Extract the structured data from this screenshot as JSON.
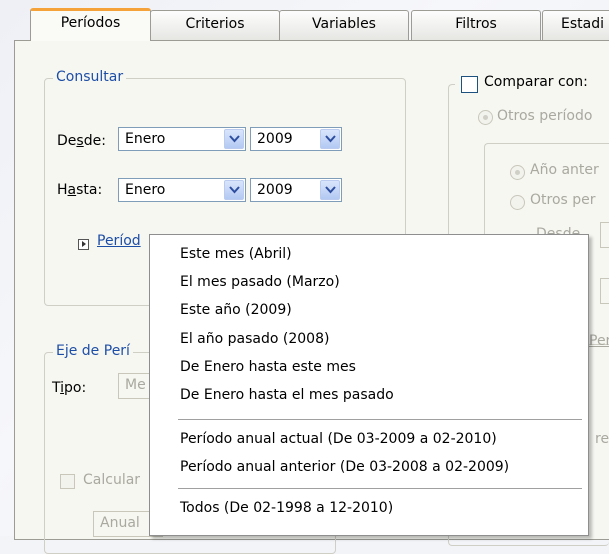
{
  "tabs": [
    {
      "label": "Períodos",
      "active": true
    },
    {
      "label": "Criterios"
    },
    {
      "label": "Variables"
    },
    {
      "label": "Filtros"
    },
    {
      "label": "Estadi"
    }
  ],
  "consultar": {
    "legend": "Consultar",
    "desde_label": "Desde:",
    "hasta_label": "Hasta:",
    "desde_month": "Enero",
    "desde_year": "2009",
    "hasta_month": "Enero",
    "hasta_year": "2009",
    "periods_link": "Períod"
  },
  "eje": {
    "legend": "Eje de Perí",
    "tipo_label": "Tipo:",
    "tipo_value": "Me",
    "calcular_label": "Calcular",
    "anual_value": "Anual"
  },
  "comparar": {
    "label": "Comparar con:",
    "otros_periodos": "Otros período",
    "anio_anterior": "Año anter",
    "otros_per": "Otros per",
    "desde_partial": "Desde",
    "per_partial": "Per",
    "re_partial": "re"
  },
  "menu": {
    "items": [
      "Este mes (Abril)",
      "El mes pasado (Marzo)",
      "Este año (2009)",
      "El año pasado (2008)",
      "De Enero hasta este mes",
      "De Enero hasta el mes pasado",
      "Período anual actual (De 03-2009 a 02-2010)",
      "Período anual anterior (De 03-2008 a 02-2009)",
      "Todos (De 02-1998 a 12-2010)"
    ]
  },
  "colors": {
    "accent_tab": "#f6a23a",
    "legend_text": "#1d4ea6"
  }
}
